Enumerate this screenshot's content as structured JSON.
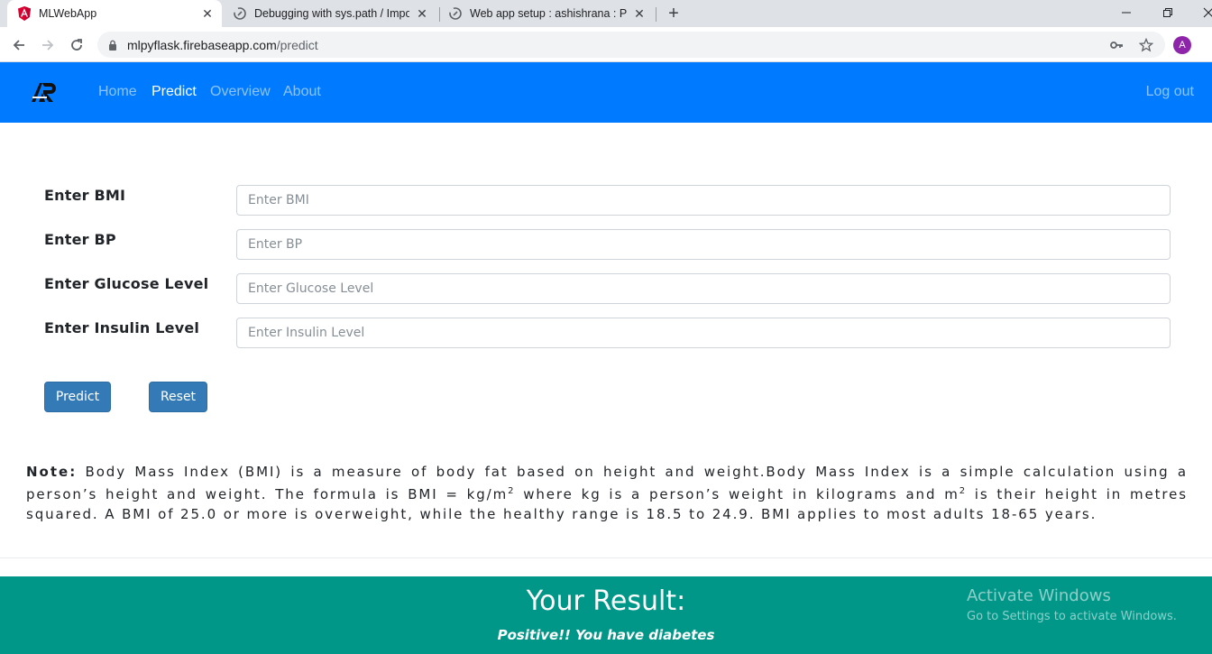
{
  "browser": {
    "tabs": [
      {
        "title": "MLWebApp",
        "icon": "angular-icon",
        "active": true
      },
      {
        "title": "Debugging with sys.path / Impor",
        "icon": "pythonanywhere-icon",
        "active": false
      },
      {
        "title": "Web app setup : ashishrana : Pyt",
        "icon": "pythonanywhere-icon",
        "active": false
      }
    ],
    "close_glyph": "✕",
    "new_tab_glyph": "+",
    "url_host": "mlpyflask.firebaseapp.com",
    "url_path": "/predict",
    "profile_initial": "A",
    "profile_color": "#8e24aa"
  },
  "navbar": {
    "logo": "AR",
    "links": [
      "Home",
      "Predict",
      "Overview",
      "About"
    ],
    "active_link": "Predict",
    "logout": "Log out",
    "bg_color": "#007bff"
  },
  "form": {
    "fields": [
      {
        "label": "Enter BMI",
        "placeholder": "Enter BMI"
      },
      {
        "label": "Enter BP",
        "placeholder": "Enter BP"
      },
      {
        "label": "Enter Glucose Level",
        "placeholder": "Enter Glucose Level"
      },
      {
        "label": "Enter Insulin Level",
        "placeholder": "Enter Insulin Level"
      }
    ],
    "predict_label": "Predict",
    "reset_label": "Reset"
  },
  "note": {
    "heading": "Note:",
    "text_1": " Body Mass Index (BMI) is a measure of body fat based on height and weight.Body Mass Index is a simple calculation using a person’s height and weight. The formula is BMI = kg/m",
    "sup_1": "2",
    "text_2": " where kg is a person’s weight in kilograms and m",
    "sup_2": "2",
    "text_3": " is their height in metres squared. A BMI of 25.0 or more is overweight, while the healthy range is 18.5 to 24.9. BMI applies to most adults 18-65 years."
  },
  "result": {
    "title": "Your Result:",
    "text": "Positive!! You have diabetes",
    "bg_color": "#009688"
  },
  "watermark": {
    "line_1": "Activate Windows",
    "line_2": "Go to Settings to activate Windows."
  }
}
